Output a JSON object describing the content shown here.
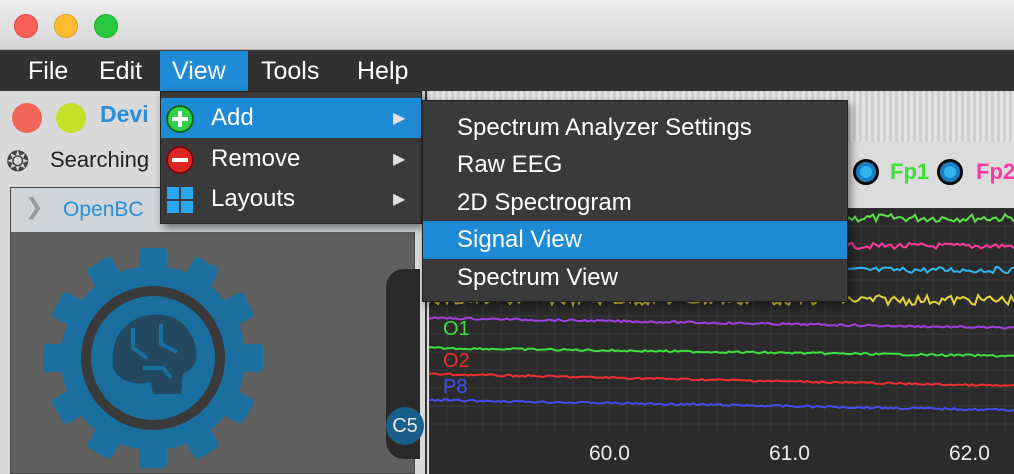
{
  "menubar": {
    "items": [
      "File",
      "Edit",
      "View",
      "Tools",
      "Help"
    ],
    "active": "View"
  },
  "view_menu": {
    "items": [
      {
        "label": "Add",
        "icon": "plus-circle-icon",
        "has_submenu": true,
        "highlighted": true
      },
      {
        "label": "Remove",
        "icon": "minus-circle-icon",
        "has_submenu": true,
        "highlighted": false
      },
      {
        "label": "Layouts",
        "icon": "grid-icon",
        "has_submenu": true,
        "highlighted": false
      }
    ],
    "arrow": "▶"
  },
  "add_submenu": {
    "items": [
      {
        "label": "Spectrum Analyzer Settings",
        "highlighted": false
      },
      {
        "label": "Raw EEG",
        "highlighted": false
      },
      {
        "label": "2D Spectrogram",
        "highlighted": false
      },
      {
        "label": "Signal View",
        "highlighted": true
      },
      {
        "label": "Spectrum View",
        "highlighted": false
      }
    ]
  },
  "left_panel": {
    "title_visible": "Devi",
    "status_visible": "Searching",
    "section_visible": "OpenBC",
    "electrode_label": "C5"
  },
  "time_series": {
    "channel_toggles": [
      {
        "label": "Fp1",
        "color": "#3fe03a"
      },
      {
        "label": "Fp2",
        "color": "#ff3aa0"
      }
    ],
    "channel_tags": [
      {
        "label": "P7",
        "color": "#a040e0"
      },
      {
        "label": "O1",
        "color": "#40e040"
      },
      {
        "label": "O2",
        "color": "#f03030"
      },
      {
        "label": "P8",
        "color": "#4050f0"
      }
    ],
    "x_ticks": [
      "60.0",
      "61.0",
      "62.0"
    ]
  },
  "colors": {
    "accent": "#1f8ad6",
    "menu_bg": "#3a3a3a",
    "menubar_bg": "#323232"
  }
}
